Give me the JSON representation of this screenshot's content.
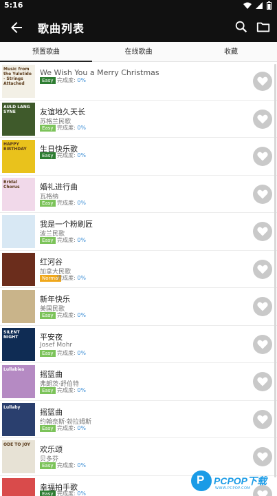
{
  "status_bar": {
    "time": "5:16"
  },
  "app_bar": {
    "title": "歌曲列表",
    "icons": [
      "back-arrow-icon",
      "search-icon",
      "folder-icon"
    ]
  },
  "tabs": [
    {
      "label": "预置歌曲",
      "selected": true
    },
    {
      "label": "在线歌曲",
      "selected": false
    },
    {
      "label": "收藏",
      "selected": false
    }
  ],
  "songs": [
    {
      "title": "We Wish You a Merry Christmas",
      "artist": "",
      "difficulty": "Easy",
      "progress_label": "完成度:",
      "progress": "0%",
      "cover_text": "Music from the Yuletide · Strings Attached",
      "cover_color": "#f3f0e6"
    },
    {
      "title": "友谊地久天长",
      "artist": "苏格兰民歌",
      "difficulty": "Easy",
      "progress_label": "完成度:",
      "progress": "0%",
      "cover_text": "AULD LANG SYNE",
      "cover_color": "#3f5a2b"
    },
    {
      "title": "生日快乐歌",
      "artist": "",
      "difficulty": "Easy",
      "progress_label": "完成度:",
      "progress": "0%",
      "cover_text": "HAPPY BIRTHDAY",
      "cover_color": "#e9c21c"
    },
    {
      "title": "婚礼进行曲",
      "artist": "瓦格纳",
      "difficulty": "Easy",
      "progress_label": "完成度:",
      "progress": "0%",
      "cover_text": "Bridal Chorus",
      "cover_color": "#f1d9ea"
    },
    {
      "title": "我是一个粉刷匠",
      "artist": "波兰民歌",
      "difficulty": "Easy",
      "progress_label": "完成度:",
      "progress": "0%",
      "cover_text": "",
      "cover_color": "#d8e8f4"
    },
    {
      "title": "红河谷",
      "artist": "加拿大民歌",
      "difficulty": "Normal",
      "progress_label": "完成度:",
      "progress": "0%",
      "cover_text": "",
      "cover_color": "#6b2d1c"
    },
    {
      "title": "新年快乐",
      "artist": "美国民歌",
      "difficulty": "Easy",
      "progress_label": "完成度:",
      "progress": "0%",
      "cover_text": "",
      "cover_color": "#c9b48a"
    },
    {
      "title": "平安夜",
      "artist": "Josef Mohr",
      "difficulty": "Easy",
      "progress_label": "完成度:",
      "progress": "0%",
      "cover_text": "SILENT NIGHT",
      "cover_color": "#0f2c54"
    },
    {
      "title": "摇篮曲",
      "artist": "弗朗茨·舒伯特",
      "difficulty": "Easy",
      "progress_label": "完成度:",
      "progress": "0%",
      "cover_text": "Lullabies",
      "cover_color": "#b58ac3"
    },
    {
      "title": "摇篮曲",
      "artist": "约翰奈斯·勃拉姆斯",
      "difficulty": "Easy",
      "progress_label": "完成度:",
      "progress": "0%",
      "cover_text": "Lullaby",
      "cover_color": "#2a3f6e"
    },
    {
      "title": "欢乐颂",
      "artist": "贝多芬",
      "difficulty": "Easy",
      "progress_label": "完成度:",
      "progress": "0%",
      "cover_text": "ODE TO JOY",
      "cover_color": "#e7e2d5"
    },
    {
      "title": "幸福拍手歌",
      "artist": "",
      "difficulty": "Easy",
      "progress_label": "完成度:",
      "progress": "0%",
      "cover_text": "",
      "cover_color": "#d94b4b"
    }
  ],
  "watermark": {
    "brand": "PCPOP下载",
    "sub": "WWW.PCPOP.COM"
  },
  "colors": {
    "app_bar": "#111111",
    "easy": "#7cc35a",
    "normal": "#f0a81c",
    "progress_value": "#3d8fd6",
    "heart_bg": "#c9c9c9"
  }
}
